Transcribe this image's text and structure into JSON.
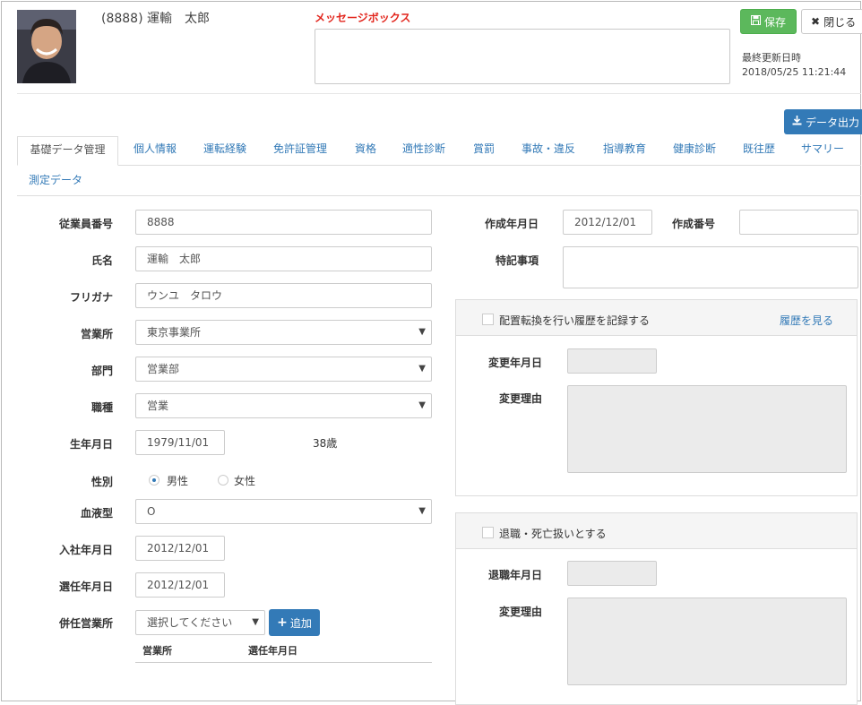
{
  "header": {
    "employee_name": "(8888) 運輸　太郎",
    "message_box_title": "メッセージボックス",
    "save_label": "保存",
    "close_label": "閉じる",
    "last_updated_label": "最終更新日時",
    "last_updated_value": "2018/05/25 11:21:44",
    "export_label": "データ出力"
  },
  "tabs": [
    {
      "label": "基礎データ管理"
    },
    {
      "label": "個人情報"
    },
    {
      "label": "運転経験"
    },
    {
      "label": "免許証管理"
    },
    {
      "label": "資格"
    },
    {
      "label": "適性診断"
    },
    {
      "label": "賞罰"
    },
    {
      "label": "事故・違反"
    },
    {
      "label": "指導教育"
    },
    {
      "label": "健康診断"
    },
    {
      "label": "既往歴"
    },
    {
      "label": "サマリー"
    },
    {
      "label": "測定データ"
    }
  ],
  "form": {
    "employee_no_label": "従業員番号",
    "employee_no_value": "8888",
    "name_label": "氏名",
    "name_value": "運輸　太郎",
    "furigana_label": "フリガナ",
    "furigana_value": "ウンユ　タロウ",
    "office_label": "営業所",
    "office_value": "東京事業所",
    "dept_label": "部門",
    "dept_value": "営業部",
    "job_label": "職種",
    "job_value": "営業",
    "birth_label": "生年月日",
    "birth_value": "1979/11/01",
    "age_value": "38歳",
    "gender_label": "性別",
    "gender_male": "男性",
    "gender_female": "女性",
    "gender_selected": "男性",
    "blood_label": "血液型",
    "blood_value": "O",
    "join_label": "入社年月日",
    "join_value": "2012/12/01",
    "appoint_label": "選任年月日",
    "appoint_value": "2012/12/01",
    "concurrent_label": "併任営業所",
    "concurrent_placeholder": "選択してください",
    "add_label": "追加",
    "table_col_office": "営業所",
    "table_col_appoint": "選任年月日"
  },
  "right": {
    "created_date_label": "作成年月日",
    "created_date_value": "2012/12/01",
    "created_no_label": "作成番号",
    "created_no_value": "",
    "notes_label": "特記事項",
    "panel1": {
      "checkbox_label": "配置転換を行い履歴を記録する",
      "history_link": "履歴を見る",
      "change_date_label": "変更年月日",
      "change_reason_label": "変更理由"
    },
    "panel2": {
      "checkbox_label": "退職・死亡扱いとする",
      "retire_date_label": "退職年月日",
      "change_reason_label": "変更理由"
    }
  },
  "colors": {
    "accent": "#337ab7",
    "save_green": "#5cb85c",
    "message_red": "#e2261d"
  }
}
